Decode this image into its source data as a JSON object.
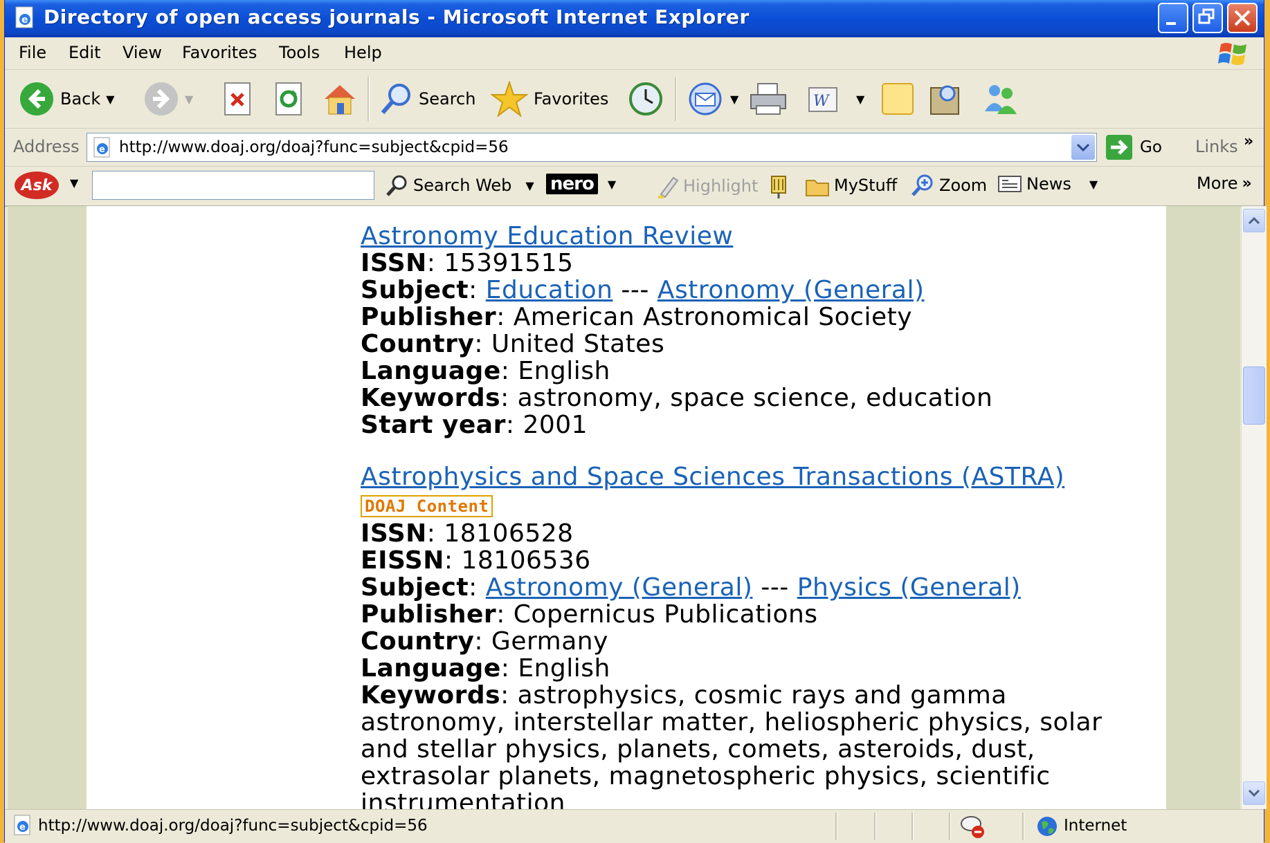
{
  "window": {
    "title": "Directory of open access journals - Microsoft Internet Explorer"
  },
  "menu": [
    "File",
    "Edit",
    "View",
    "Favorites",
    "Tools",
    "Help"
  ],
  "toolbar": {
    "back_label": "Back",
    "search_label": "Search",
    "favorites_label": "Favorites"
  },
  "address": {
    "label": "Address",
    "url": "http://www.doaj.org/doaj?func=subject&cpid=56",
    "go_label": "Go",
    "links_label": "Links"
  },
  "ask_toolbar": {
    "logo": "Ask",
    "search_value": "",
    "search_web_label": "Search Web",
    "nero_label": "nero",
    "highlight_label": "Highlight",
    "mystuff_label": "MyStuff",
    "zoom_label": "Zoom",
    "news_label": "News",
    "more_label": "More"
  },
  "journals": [
    {
      "title": "Astronomy Education Review",
      "badge": "",
      "issn_label": "ISSN",
      "issn": "15391515",
      "subject_label": "Subject",
      "subjects": [
        "Education",
        "Astronomy (General)"
      ],
      "subject_sep": "---",
      "publisher_label": "Publisher",
      "publisher": "American Astronomical Society",
      "country_label": "Country",
      "country": "United States",
      "language_label": "Language",
      "language": "English",
      "keywords_label": "Keywords",
      "keywords": "astronomy, space science, education",
      "start_year_label": "Start year",
      "start_year": "2001"
    },
    {
      "title": "Astrophysics and Space Sciences Transactions (ASTRA)",
      "badge": "DOAJ Content",
      "issn_label": "ISSN",
      "issn": "18106528",
      "eissn_label": "EISSN",
      "eissn": "18106536",
      "subject_label": "Subject",
      "subjects": [
        "Astronomy (General)",
        "Physics (General)"
      ],
      "subject_sep": "---",
      "publisher_label": "Publisher",
      "publisher": "Copernicus Publications",
      "country_label": "Country",
      "country": "Germany",
      "language_label": "Language",
      "language": "English",
      "keywords_label": "Keywords",
      "keywords_lines": [
        "astrophysics, cosmic rays and gamma",
        "astronomy, interstellar matter, heliospheric physics, solar",
        "and stellar physics, planets, comets, asteroids, dust,",
        "extrasolar planets, magnetospheric physics, scientific",
        "instrumentation"
      ]
    }
  ],
  "status": {
    "text": "http://www.doaj.org/doaj?func=subject&cpid=56",
    "zone": "Internet"
  },
  "colors": {
    "titlebar": "#0a4fd6",
    "link": "#1a62b7",
    "badge": "#e07800",
    "page_margin": "#d8dbbf"
  }
}
